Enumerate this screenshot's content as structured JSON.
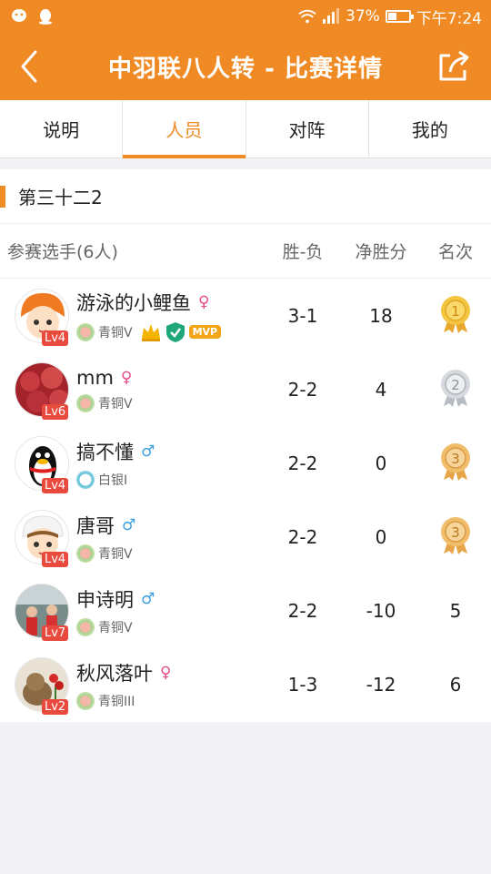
{
  "status_bar": {
    "battery_percent": "37%",
    "time": "下午7:24"
  },
  "header": {
    "title": "中羽联八人转 - 比赛详情",
    "back_icon": "chevron-left-icon",
    "share_icon": "share-icon"
  },
  "tabs": [
    {
      "label": "说明",
      "active": false
    },
    {
      "label": "人员",
      "active": true
    },
    {
      "label": "对阵",
      "active": false
    },
    {
      "label": "我的",
      "active": false
    }
  ],
  "group": {
    "title": "第三十二2"
  },
  "table": {
    "headers": {
      "players": "参赛选手(6人)",
      "win_loss": "胜-负",
      "net_points": "净胜分",
      "rank": "名次"
    },
    "rows": [
      {
        "name": "游泳的小鲤鱼",
        "gender": "♀",
        "gender_type": "female",
        "level": "Lv4",
        "tier": "青铜V",
        "tier_type": "bronze",
        "win_loss": "3-1",
        "net": "18",
        "rank": "1",
        "rank_medal": "gold",
        "badges": [
          "crown",
          "shield",
          "MVP"
        ]
      },
      {
        "name": "mm",
        "gender": "♀",
        "gender_type": "female",
        "level": "Lv6",
        "tier": "青铜V",
        "tier_type": "bronze",
        "win_loss": "2-2",
        "net": "4",
        "rank": "2",
        "rank_medal": "silver",
        "badges": []
      },
      {
        "name": "搞不懂",
        "gender": "♂",
        "gender_type": "male",
        "level": "Lv4",
        "tier": "白银I",
        "tier_type": "silver",
        "win_loss": "2-2",
        "net": "0",
        "rank": "3",
        "rank_medal": "bronze",
        "badges": []
      },
      {
        "name": "唐哥",
        "gender": "♂",
        "gender_type": "male",
        "level": "Lv4",
        "tier": "青铜V",
        "tier_type": "bronze",
        "win_loss": "2-2",
        "net": "0",
        "rank": "3",
        "rank_medal": "bronze",
        "badges": []
      },
      {
        "name": "申诗明",
        "gender": "♂",
        "gender_type": "male",
        "level": "Lv7",
        "tier": "青铜V",
        "tier_type": "bronze",
        "win_loss": "2-2",
        "net": "-10",
        "rank": "5",
        "rank_medal": "",
        "badges": []
      },
      {
        "name": "秋风落叶",
        "gender": "♀",
        "gender_type": "female",
        "level": "Lv2",
        "tier": "青铜III",
        "tier_type": "bronze",
        "win_loss": "1-3",
        "net": "-12",
        "rank": "6",
        "rank_medal": "",
        "badges": []
      }
    ]
  },
  "colors": {
    "accent": "#f08a24",
    "female": "#e84b8a",
    "male": "#3ba0e0",
    "level_badge": "#e84a3e"
  }
}
